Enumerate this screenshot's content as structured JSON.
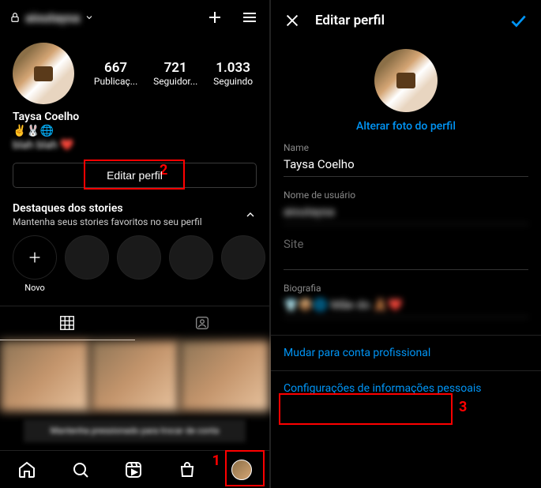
{
  "left": {
    "username_blurred": "aioutaysa",
    "stats": {
      "posts": {
        "num": "667",
        "label": "Publicaç..."
      },
      "followers": {
        "num": "721",
        "label": "Seguidor..."
      },
      "following": {
        "num": "1.033",
        "label": "Seguindo"
      }
    },
    "display_name": "Taysa Coelho",
    "bio_emojis": "✌️🐰🌐",
    "bio_text_blurred": "blah blah ❤️",
    "edit_button": "Editar perfil",
    "highlights": {
      "title": "Destaques dos stories",
      "subtitle": "Mantenha seus stories favoritos no seu perfil",
      "new_label": "Novo"
    },
    "grid_overlay_text": "Mantenha pressionado para trocar de conta",
    "annotations": {
      "one": "1",
      "two": "2"
    }
  },
  "right": {
    "title": "Editar perfil",
    "change_photo": "Alterar foto do perfil",
    "fields": {
      "name": {
        "label": "Name",
        "value": "Taysa Coelho"
      },
      "username": {
        "label": "Nome de usuário",
        "value_blurred": "aioutaysa"
      },
      "site": {
        "label": "Site",
        "value": ""
      },
      "bio": {
        "label": "Biografia",
        "value_icons": "👕📦🌐 Mãe do 🧸❤️"
      }
    },
    "links": {
      "switch_pro": "Mudar para conta profissional",
      "personal_info": "Configurações de informações pessoais"
    },
    "annotations": {
      "three": "3"
    }
  }
}
